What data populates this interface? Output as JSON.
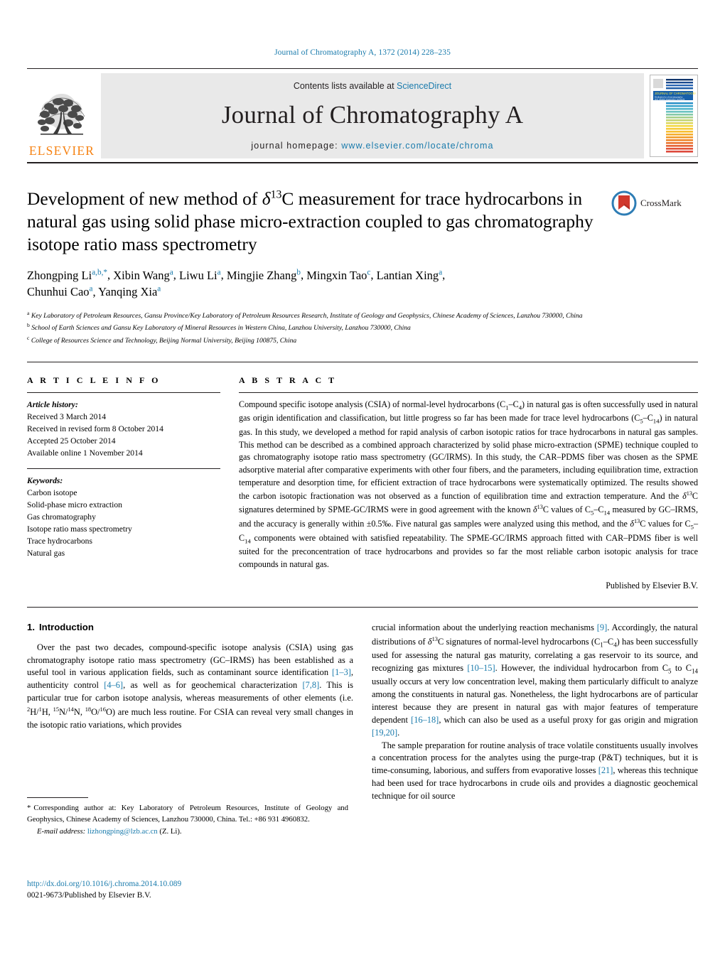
{
  "running_head": "Journal of Chromatography A, 1372 (2014) 228–235",
  "masthead": {
    "contents_prefix": "Contents lists available at ",
    "contents_link": "ScienceDirect",
    "journal_title": "Journal of Chromatography A",
    "homepage_label": "journal homepage:",
    "homepage_url": "www.elsevier.com/locate/chroma",
    "publisher_wordmark": "ELSEVIER"
  },
  "title": {
    "line1_a": "Development of new method of ",
    "delta": "δ",
    "sup13": "13",
    "line1_b": "C measurement for trace",
    "line2": "hydrocarbons in natural gas using solid phase micro-extraction",
    "line3": "coupled to gas chromatography isotope ratio mass spectrometry",
    "full": "Development of new method of δ13C measurement for trace hydrocarbons in natural gas using solid phase micro-extraction coupled to gas chromatography isotope ratio mass spectrometry"
  },
  "crossmark": {
    "label": "CrossMark"
  },
  "authors": [
    {
      "name": "Zhongping Li",
      "marks": "a,b,",
      "star": true
    },
    {
      "name": "Xibin Wang",
      "marks": "a"
    },
    {
      "name": "Liwu Li",
      "marks": "a"
    },
    {
      "name": "Mingjie Zhang",
      "marks": "b"
    },
    {
      "name": "Mingxin Tao",
      "marks": "c"
    },
    {
      "name": "Lantian Xing",
      "marks": "a"
    },
    {
      "name": "Chunhui Cao",
      "marks": "a"
    },
    {
      "name": "Yanqing Xia",
      "marks": "a"
    }
  ],
  "affiliations": [
    {
      "mark": "a",
      "text": "Key Laboratory of Petroleum Resources, Gansu Province/Key Laboratory of Petroleum Resources Research, Institute of Geology and Geophysics, Chinese Academy of Sciences, Lanzhou 730000, China"
    },
    {
      "mark": "b",
      "text": "School of Earth Sciences and Gansu Key Laboratory of Mineral Resources in Western China, Lanzhou University, Lanzhou 730000, China"
    },
    {
      "mark": "c",
      "text": "College of Resources Science and Technology, Beijing Normal University, Beijing 100875, China"
    }
  ],
  "article_info": {
    "heading": "A R T I C L E   I N F O",
    "history_label": "Article history:",
    "history": [
      "Received 3 March 2014",
      "Received in revised form 8 October 2014",
      "Accepted 25 October 2014",
      "Available online 1 November 2014"
    ],
    "keywords_label": "Keywords:",
    "keywords": [
      "Carbon isotope",
      "Solid-phase micro extraction",
      "Gas chromatography",
      "Isotope ratio mass spectrometry",
      "Trace hydrocarbons",
      "Natural gas"
    ]
  },
  "abstract": {
    "heading": "A B S T R A C T",
    "paragraph": "Compound specific isotope analysis (CSIA) of normal-level hydrocarbons (C1–C4) in natural gas is often successfully used in natural gas origin identification and classification, but little progress so far has been made for trace level hydrocarbons (C5–C14) in natural gas. In this study, we developed a method for rapid analysis of carbon isotopic ratios for trace hydrocarbons in natural gas samples. This method can be described as a combined approach characterized by solid phase micro-extraction (SPME) technique coupled to gas chromatography isotope ratio mass spectrometry (GC/IRMS). In this study, the CAR–PDMS fiber was chosen as the SPME adsorptive material after comparative experiments with other four fibers, and the parameters, including equilibration time, extraction temperature and desorption time, for efficient extraction of trace hydrocarbons were systematically optimized. The results showed the carbon isotopic fractionation was not observed as a function of equilibration time and extraction temperature. And the δ13C signatures determined by SPME-GC/IRMS were in good agreement with the known δ13C values of C5–C14 measured by GC–IRMS, and the accuracy is generally within ±0.5‰. Five natural gas samples were analyzed using this method, and the δ13C values for C5–C14 components were obtained with satisfied repeatability. The SPME-GC/IRMS approach fitted with CAR–PDMS fiber is well suited for the preconcentration of trace hydrocarbons and provides so far the most reliable carbon isotopic analysis for trace compounds in natural gas.",
    "published_by": "Published by Elsevier B.V."
  },
  "introduction": {
    "number": "1.",
    "title": "Introduction",
    "para1": "Over the past two decades, compound-specific isotope analysis (CSIA) using gas chromatography isotope ratio mass spectrometry (GC–IRMS) has been established as a useful tool in various application fields, such as contaminant source identification [1–3], authenticity control [4–6], as well as for geochemical characterization [7,8]. This is particular true for carbon isotope analysis, whereas measurements of other elements (i.e. 2H/1H, 15N/14N, 18O/16O) are much less routine. For CSIA can reveal very small changes in the isotopic ratio variations, which provides",
    "para2": "crucial information about the underlying reaction mechanisms [9]. Accordingly, the natural distributions of δ13C signatures of normal-level hydrocarbons (C1–C4) has been successfully used for assessing the natural gas maturity, correlating a gas reservoir to its source, and recognizing gas mixtures [10–15]. However, the individual hydrocarbon from C5 to C14 usually occurs at very low concentration level, making them particularly difficult to analyze among the constituents in natural gas. Nonetheless, the light hydrocarbons are of particular interest because they are present in natural gas with major features of temperature dependent [16–18], which can also be used as a useful proxy for gas origin and migration [19,20].",
    "para3": "The sample preparation for routine analysis of trace volatile constituents usually involves a concentration process for the analytes using the purge-trap (P&T) techniques, but it is time-consuming, laborious, and suffers from evaporative losses [21], whereas this technique had been used for trace hydrocarbons in crude oils and provides a diagnostic geochemical technique for oil source"
  },
  "footnote": {
    "star": "*",
    "corresponding": "Corresponding author at: Key Laboratory of Petroleum Resources, Institute of Geology and Geophysics, Chinese Academy of Sciences, Lanzhou 730000, China.",
    "tel": "Tel.: +86 931 4960832.",
    "email_label": "E-mail address:",
    "email": "lizhongping@lzb.ac.cn",
    "email_suffix": "(Z. Li)."
  },
  "doi_block": {
    "doi": "http://dx.doi.org/10.1016/j.chroma.2014.10.089",
    "issn_line": "0021-9673/Published by Elsevier B.V."
  },
  "colors": {
    "link_blue": "#1a7bac",
    "elsevier_orange": "#f68212",
    "rule_black": "#231f20",
    "masthead_grey": "#e9e9e9"
  }
}
